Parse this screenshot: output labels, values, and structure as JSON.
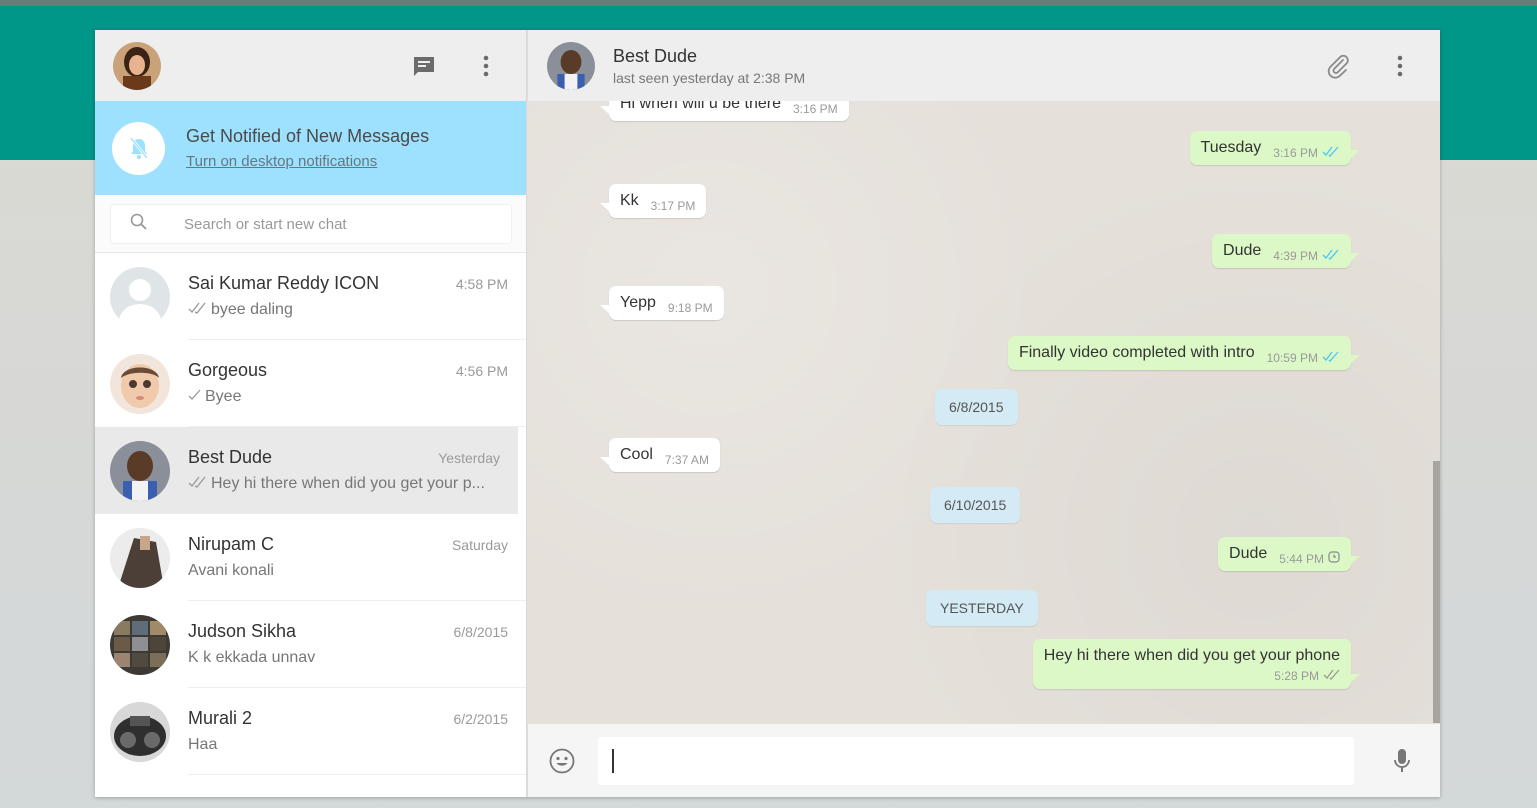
{
  "sidebar": {
    "notification": {
      "title": "Get Notified of New Messages",
      "link": "Turn on desktop notifications"
    },
    "search": {
      "placeholder": "Search or start new chat"
    },
    "chats": [
      {
        "name": "Sai Kumar Reddy ICON",
        "time": "4:58 PM",
        "preview": "byee daling",
        "tick": "double"
      },
      {
        "name": "Gorgeous",
        "time": "4:56 PM",
        "preview": "Byee",
        "tick": "single"
      },
      {
        "name": "Best Dude",
        "time": "Yesterday",
        "preview": "Hey hi there when did you get your p...",
        "tick": "double"
      },
      {
        "name": "Nirupam C",
        "time": "Saturday",
        "preview": "Avani konali",
        "tick": "none"
      },
      {
        "name": "Judson Sikha",
        "time": "6/8/2015",
        "preview": "K k ekkada unnav",
        "tick": "none"
      },
      {
        "name": "Murali 2",
        "time": "6/2/2015",
        "preview": "Haa",
        "tick": "none"
      }
    ]
  },
  "conversation": {
    "contact_name": "Best Dude",
    "contact_status": "last seen yesterday at 2:38 PM",
    "messages": [
      {
        "dir": "in",
        "text": "Hi when will u be there",
        "time": "3:16 PM"
      },
      {
        "dir": "out",
        "text": "Tuesday",
        "time": "3:16 PM",
        "status": "read"
      },
      {
        "dir": "in",
        "text": "Kk",
        "time": "3:17 PM"
      },
      {
        "dir": "out",
        "text": "Dude",
        "time": "4:39 PM",
        "status": "read"
      },
      {
        "dir": "in",
        "text": "Yepp",
        "time": "9:18 PM"
      },
      {
        "dir": "out",
        "text": "Finally video completed with intro",
        "time": "10:59 PM",
        "status": "read"
      },
      {
        "date": "6/8/2015"
      },
      {
        "dir": "in",
        "text": "Cool",
        "time": "7:37 AM"
      },
      {
        "date": "6/10/2015"
      },
      {
        "dir": "out",
        "text": "Dude",
        "time": "5:44 PM",
        "status": "pending"
      },
      {
        "date": "YESTERDAY"
      },
      {
        "dir": "out",
        "text": "Hey hi there when did you get your phone",
        "time": "5:28 PM",
        "status": "delivered"
      }
    ]
  },
  "icons": {
    "new_chat": "chat-icon",
    "menu": "more-vert-icon",
    "attach": "paperclip-icon",
    "emoji": "smiley-icon",
    "mic": "mic-icon",
    "search": "search-icon",
    "notif": "bell-off-icon"
  },
  "colors": {
    "brand": "#009688",
    "notif_bg": "#9de1fe",
    "outgoing_bubble": "#dcf8c6",
    "incoming_bubble": "#ffffff",
    "read_tick": "#4fc3f7",
    "date_chip": "#d4eaf4"
  }
}
